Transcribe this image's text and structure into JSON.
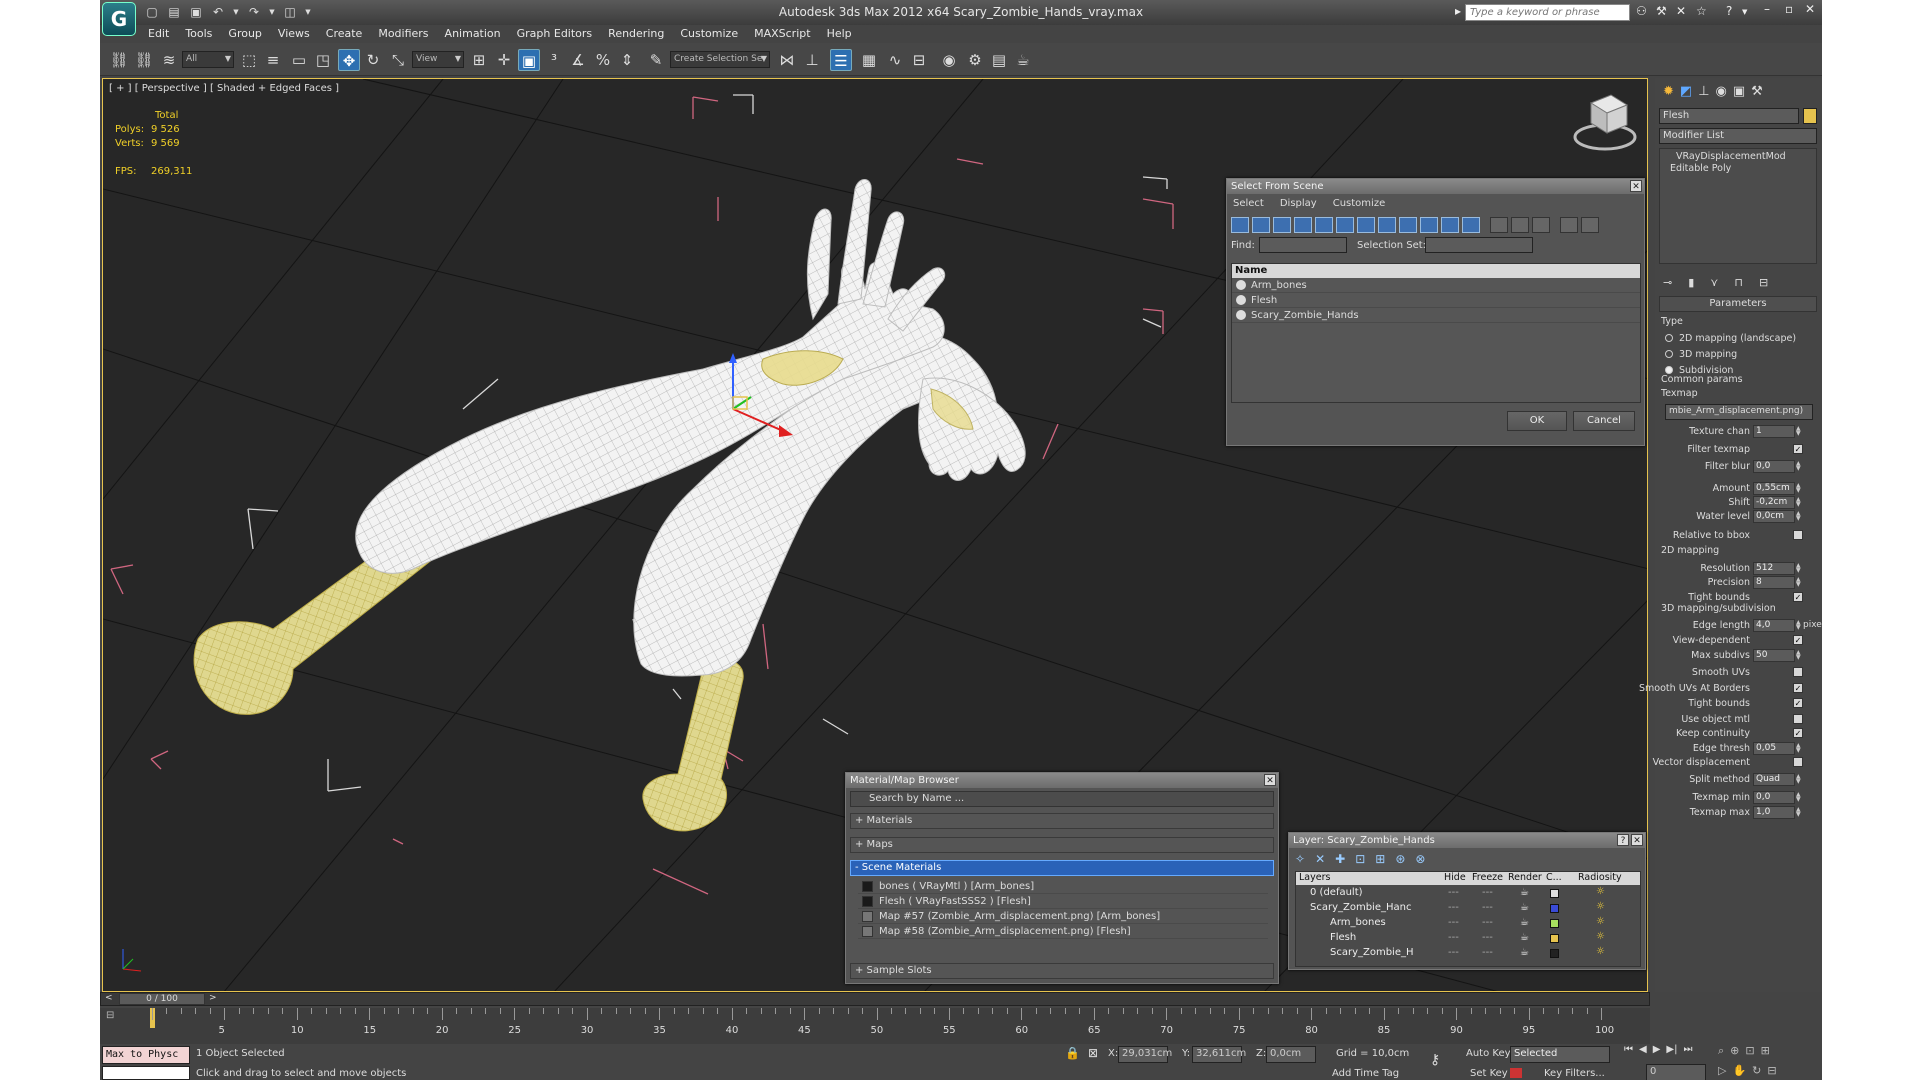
{
  "window": {
    "title": "Autodesk 3ds Max  2012 x64      Scary_Zombie_Hands_vray.max",
    "search_placeholder": "Type a keyword or phrase"
  },
  "menu": [
    "Edit",
    "Tools",
    "Group",
    "Views",
    "Create",
    "Modifiers",
    "Animation",
    "Graph Editors",
    "Rendering",
    "Customize",
    "MAXScript",
    "Help"
  ],
  "toolbar": {
    "filter_value": "All",
    "refcoord_value": "View",
    "selection_set_placeholder": "Create Selection Se"
  },
  "viewport": {
    "label": "[ + ] [ Perspective ] [ Shaded + Edged Faces ]",
    "stats": {
      "total_label": "Total",
      "polys_label": "Polys:",
      "polys": "9 526",
      "verts_label": "Verts:",
      "verts": "9 569",
      "fps_label": "FPS:",
      "fps": "269,311"
    }
  },
  "select_from_scene": {
    "title": "Select From Scene",
    "menus": [
      "Select",
      "Display",
      "Customize"
    ],
    "find_label": "Find:",
    "selection_set_label": "Selection Set:",
    "column_name": "Name",
    "items": [
      "Arm_bones",
      "Flesh",
      "Scary_Zombie_Hands"
    ],
    "ok": "OK",
    "cancel": "Cancel"
  },
  "material_browser": {
    "title": "Material/Map Browser",
    "search_placeholder": "Search by Name ...",
    "groups": {
      "materials": "+ Materials",
      "maps": "+ Maps",
      "scene": "- Scene Materials",
      "samples": "+ Sample Slots"
    },
    "scene_items": [
      "bones  ( VRayMtl )  [Arm_bones]",
      "Flesh  ( VRayFastSSS2 )  [Flesh]",
      "Map #57 (Zombie_Arm_displacement.png) [Arm_bones]",
      "Map #58 (Zombie_Arm_displacement.png) [Flesh]"
    ]
  },
  "layer_dialog": {
    "title": "Layer: Scary_Zombie_Hands",
    "help": "?",
    "columns": {
      "layers": "Layers",
      "hide": "Hide",
      "freeze": "Freeze",
      "render": "Render",
      "color": "C...",
      "radiosity": "Radiosity"
    },
    "rows": [
      {
        "name": "0 (default)",
        "color": "#dddddd"
      },
      {
        "name": "Scary_Zombie_Hanc",
        "color": "#3a4bd6"
      },
      {
        "name": "Arm_bones",
        "color": "#a8e060"
      },
      {
        "name": "Flesh",
        "color": "#e6c34e"
      },
      {
        "name": "Scary_Zombie_H",
        "color": "#222222"
      }
    ]
  },
  "command_panel": {
    "object_name": "Flesh",
    "object_color": "#e6c34e",
    "modifier_list": "Modifier List",
    "stack": [
      "VRayDisplacementMod",
      "Editable Poly"
    ],
    "parameters_title": "Parameters",
    "type_label": "Type",
    "type_options": [
      "2D mapping (landscape)",
      "3D mapping",
      "Subdivision"
    ],
    "common_params": "Common params",
    "texmap_label": "Texmap",
    "texmap_value": "mbie_Arm_displacement.png)",
    "rows": {
      "texture_chan": {
        "label": "Texture chan",
        "value": "1"
      },
      "filter_texmap": {
        "label": "Filter texmap"
      },
      "filter_blur": {
        "label": "Filter blur",
        "value": "0,0"
      },
      "amount": {
        "label": "Amount",
        "value": "0,55cm"
      },
      "shift": {
        "label": "Shift",
        "value": "-0,2cm"
      },
      "water_level": {
        "label": "Water level",
        "value": "0,0cm"
      },
      "relative_to_bbox": {
        "label": "Relative to bbox"
      },
      "resolution": {
        "label": "Resolution",
        "value": "512"
      },
      "precision": {
        "label": "Precision",
        "value": "8"
      },
      "tight_bounds": {
        "label": "Tight bounds"
      },
      "edge_length": {
        "label": "Edge length",
        "value": "4,0",
        "unit": "pixels"
      },
      "view_dependent": {
        "label": "View-dependent"
      },
      "max_subdivs": {
        "label": "Max subdivs",
        "value": "50"
      },
      "smooth_uvs": {
        "label": "Smooth UVs"
      },
      "smooth_uvs_borders": {
        "label": "Smooth UVs At Borders"
      },
      "tight_bounds2": {
        "label": "Tight bounds"
      },
      "use_object_mtl": {
        "label": "Use object mtl"
      },
      "keep_continuity": {
        "label": "Keep continuity"
      },
      "edge_thresh": {
        "label": "Edge thresh",
        "value": "0,05"
      },
      "vector_displacement": {
        "label": "Vector displacement"
      },
      "split_method": {
        "label": "Split method",
        "value": "Quad"
      },
      "texmap_min": {
        "label": "Texmap min",
        "value": "0,0"
      },
      "texmap_max": {
        "label": "Texmap max",
        "value": "1,0"
      }
    },
    "mapping_2d": "2D mapping",
    "mapping_3d": "3D mapping/subdivision"
  },
  "timeline": {
    "position": "0 / 100",
    "ticks": [
      "5",
      "10",
      "15",
      "20",
      "25",
      "30",
      "35",
      "40",
      "45",
      "50",
      "55",
      "60",
      "65",
      "70",
      "75",
      "80",
      "85",
      "90",
      "95",
      "100"
    ]
  },
  "status": {
    "maxscript": "Max to Physc",
    "selected": "1 Object Selected",
    "prompt": "Click and drag to select and move objects",
    "x_label": "X:",
    "x": "29,031cm",
    "y_label": "Y:",
    "y": "32,611cm",
    "z_label": "Z:",
    "z": "0,0cm",
    "grid": "Grid = 10,0cm",
    "auto_key": "Auto Key",
    "set_key": "Set Key",
    "key_mode": "Selected",
    "key_filters": "Key Filters...",
    "add_time_tag": "Add Time Tag",
    "frame": "0"
  }
}
